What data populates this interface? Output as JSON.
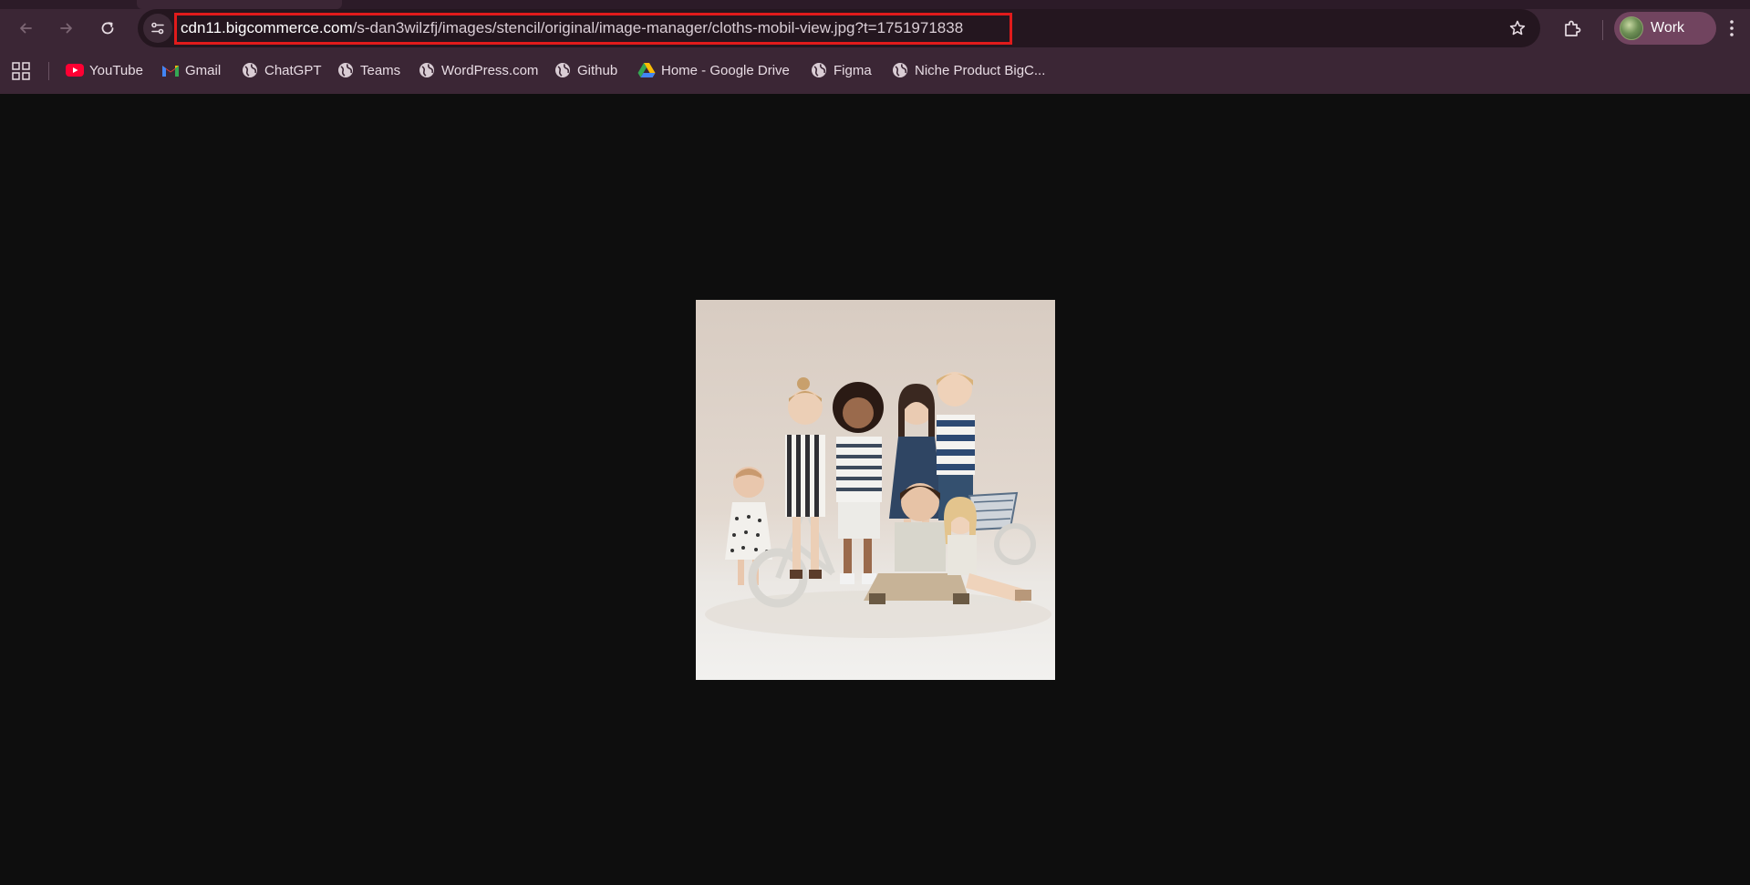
{
  "browser": {
    "url": {
      "host": "cdn11.bigcommerce.com",
      "path": "/s-dan3wilzfj/images/stencil/original/image-manager/cloths-mobil-view.jpg?t=1751971838"
    },
    "profile": {
      "label": "Work"
    },
    "bookmarks": [
      {
        "label": "YouTube",
        "icon": "youtube-icon"
      },
      {
        "label": "Gmail",
        "icon": "gmail-icon"
      },
      {
        "label": "ChatGPT",
        "icon": "globe-icon"
      },
      {
        "label": "Teams",
        "icon": "globe-icon"
      },
      {
        "label": "WordPress.com",
        "icon": "globe-icon"
      },
      {
        "label": "Github",
        "icon": "globe-icon"
      },
      {
        "label": "Home - Google Drive",
        "icon": "google-drive-icon"
      },
      {
        "label": "Figma",
        "icon": "globe-icon"
      },
      {
        "label": "Niche Product BigC...",
        "icon": "globe-icon"
      }
    ],
    "colors": {
      "chrome": "#3b2635",
      "omnibox": "#24161f",
      "url_highlight": "#e01b1b",
      "page_background": "#0e0e0e",
      "profile_chip": "#71445f"
    }
  },
  "page": {
    "image_content": "children-clothing-photo"
  }
}
